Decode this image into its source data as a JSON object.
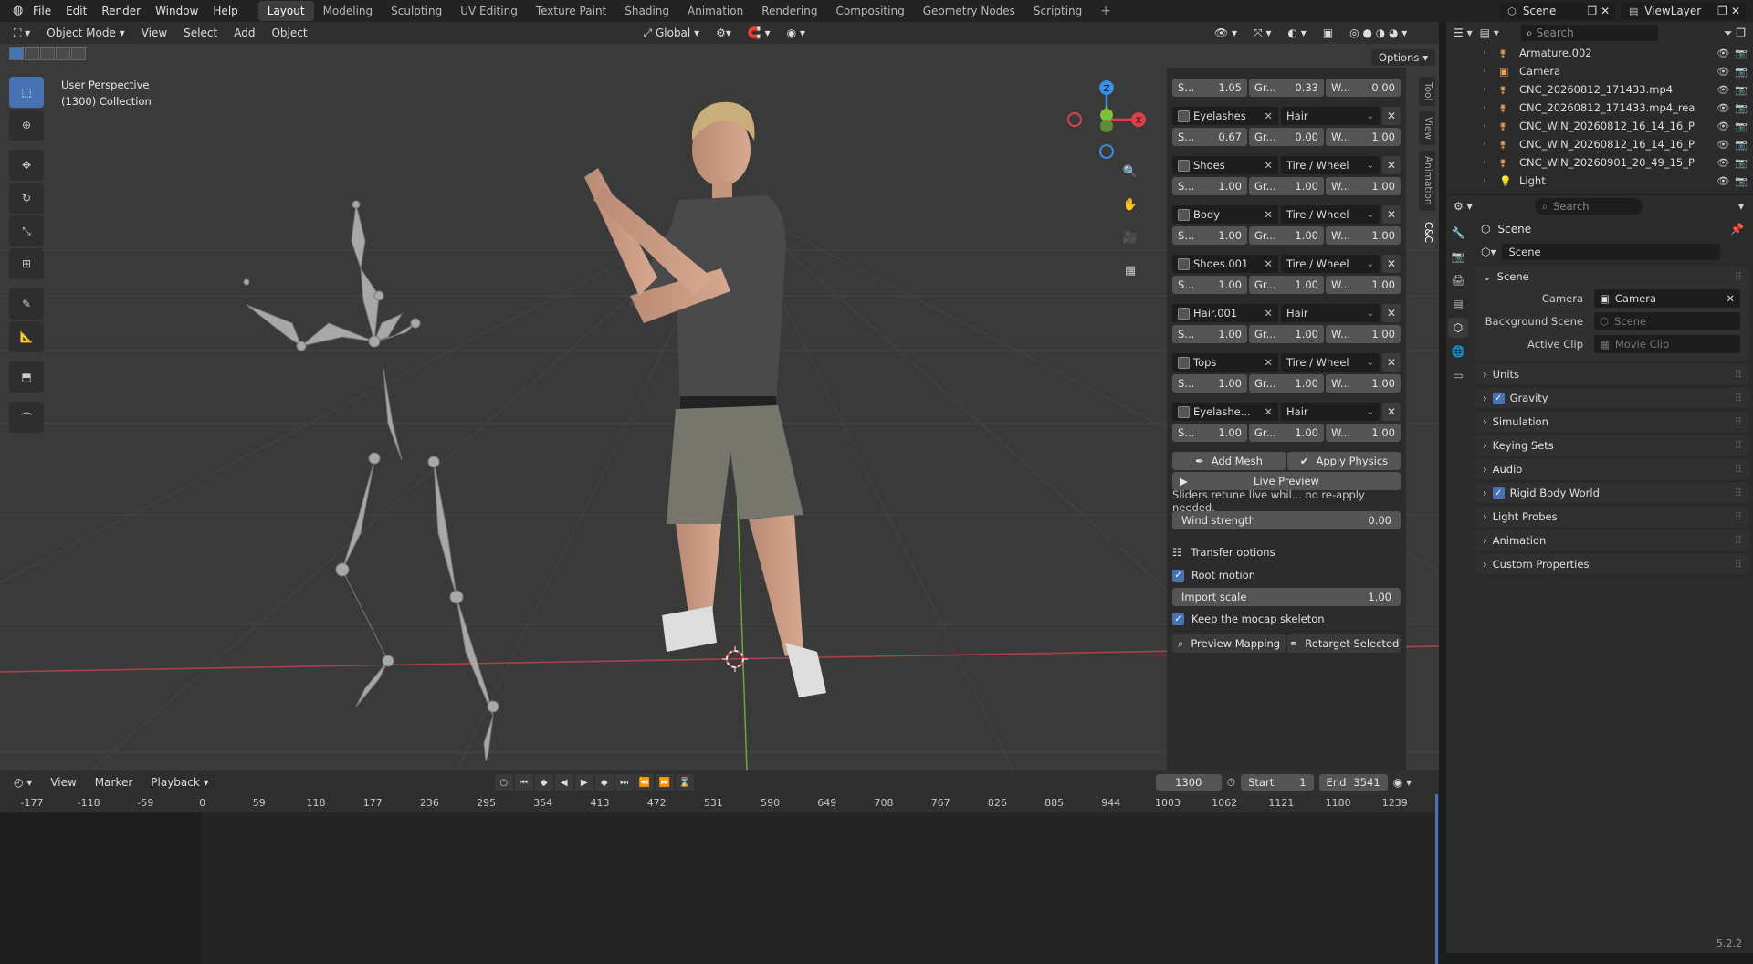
{
  "menu": {
    "items": [
      "File",
      "Edit",
      "Render",
      "Window",
      "Help"
    ]
  },
  "workspaces": {
    "tabs": [
      "Layout",
      "Modeling",
      "Sculpting",
      "UV Editing",
      "Texture Paint",
      "Shading",
      "Animation",
      "Rendering",
      "Compositing",
      "Geometry Nodes",
      "Scripting"
    ],
    "active": "Layout",
    "plus": "+"
  },
  "topright": {
    "scene": "Scene",
    "view_layer": "ViewLayer"
  },
  "viewport": {
    "mode": "Object Mode",
    "menus": [
      "View",
      "Select",
      "Add",
      "Object"
    ],
    "orientation": "Global",
    "options_label": "Options",
    "info_line1": "User Perspective",
    "info_line2": "(1300) Collection",
    "gizmo": {
      "z": "Z",
      "x": "X"
    },
    "side_tabs": [
      "Tool",
      "View",
      "Animation",
      "C&C"
    ],
    "active_side_tab": "C&C"
  },
  "npanel": {
    "top_partial": {
      "s_label": "S...",
      "s": "1.05",
      "g_label": "Gr...",
      "g": "0.33",
      "w_label": "W...",
      "w": "0.00"
    },
    "materials": [
      {
        "name": "Eyelashes",
        "type": "Hair",
        "s": "0.67",
        "g": "0.00",
        "w": "1.00"
      },
      {
        "name": "Shoes",
        "type": "Tire / Wheel",
        "s": "1.00",
        "g": "1.00",
        "w": "1.00"
      },
      {
        "name": "Body",
        "type": "Tire / Wheel",
        "s": "1.00",
        "g": "1.00",
        "w": "1.00"
      },
      {
        "name": "Shoes.001",
        "type": "Tire / Wheel",
        "s": "1.00",
        "g": "1.00",
        "w": "1.00"
      },
      {
        "name": "Hair.001",
        "type": "Hair",
        "s": "1.00",
        "g": "1.00",
        "w": "1.00"
      },
      {
        "name": "Tops",
        "type": "Tire / Wheel",
        "s": "1.00",
        "g": "1.00",
        "w": "1.00"
      },
      {
        "name": "Eyelashe...",
        "type": "Hair",
        "s": "1.00",
        "g": "1.00",
        "w": "1.00"
      }
    ],
    "labels": {
      "s": "S...",
      "g": "Gr...",
      "w": "W..."
    },
    "add_mesh": "Add Mesh",
    "apply_physics": "Apply Physics",
    "live_preview": "Live Preview",
    "note": "Sliders retune live whil... no re-apply needed.",
    "wind_label": "Wind strength",
    "wind_value": "0.00",
    "transfer_options": "Transfer options",
    "root_motion": "Root motion",
    "import_scale_label": "Import scale",
    "import_scale_value": "1.00",
    "keep_skeleton": "Keep the mocap skeleton",
    "preview_mapping": "Preview Mapping",
    "retarget_selected": "Retarget Selected"
  },
  "timeline": {
    "menus": [
      "View",
      "Marker",
      "Playback"
    ],
    "current_frame": "1300",
    "start_label": "Start",
    "start": "1",
    "end_label": "End",
    "end": "3541",
    "ruler": [
      "-177",
      "-118",
      "-59",
      "0",
      "59",
      "118",
      "177",
      "236",
      "295",
      "354",
      "413",
      "472",
      "531",
      "590",
      "649",
      "708",
      "767",
      "826",
      "885",
      "944",
      "1003",
      "1062",
      "1121",
      "1180",
      "1239"
    ]
  },
  "outliner": {
    "search_placeholder": "Search",
    "items": [
      {
        "name": "Armature.002"
      },
      {
        "name": "Camera"
      },
      {
        "name": "CNC_20260812_171433.mp4"
      },
      {
        "name": "CNC_20260812_171433.mp4_rea"
      },
      {
        "name": "CNC_WIN_20260812_16_14_16_P"
      },
      {
        "name": "CNC_WIN_20260812_16_14_16_P"
      },
      {
        "name": "CNC_WIN_20260901_20_49_15_P"
      },
      {
        "name": "Light"
      }
    ]
  },
  "properties": {
    "search_placeholder": "Search",
    "title": "Scene",
    "datablock": "Scene",
    "scene_panel": "Scene",
    "camera_label": "Camera",
    "camera_value": "Camera",
    "bg_label": "Background Scene",
    "bg_placeholder": "Scene",
    "clip_label": "Active Clip",
    "clip_placeholder": "Movie Clip",
    "panels": [
      {
        "label": "Units",
        "checkbox": false
      },
      {
        "label": "Gravity",
        "checkbox": true
      },
      {
        "label": "Simulation",
        "checkbox": false
      },
      {
        "label": "Keying Sets",
        "checkbox": false
      },
      {
        "label": "Audio",
        "checkbox": false
      },
      {
        "label": "Rigid Body World",
        "checkbox": true
      },
      {
        "label": "Light Probes",
        "checkbox": false
      },
      {
        "label": "Animation",
        "checkbox": false
      },
      {
        "label": "Custom Properties",
        "checkbox": false
      }
    ]
  },
  "version": "5.2.2",
  "colors": {
    "accent": "#4772b3",
    "x_axis": "#d9424a",
    "y_axis": "#7bbf3b",
    "z_axis": "#3c8fe0"
  }
}
